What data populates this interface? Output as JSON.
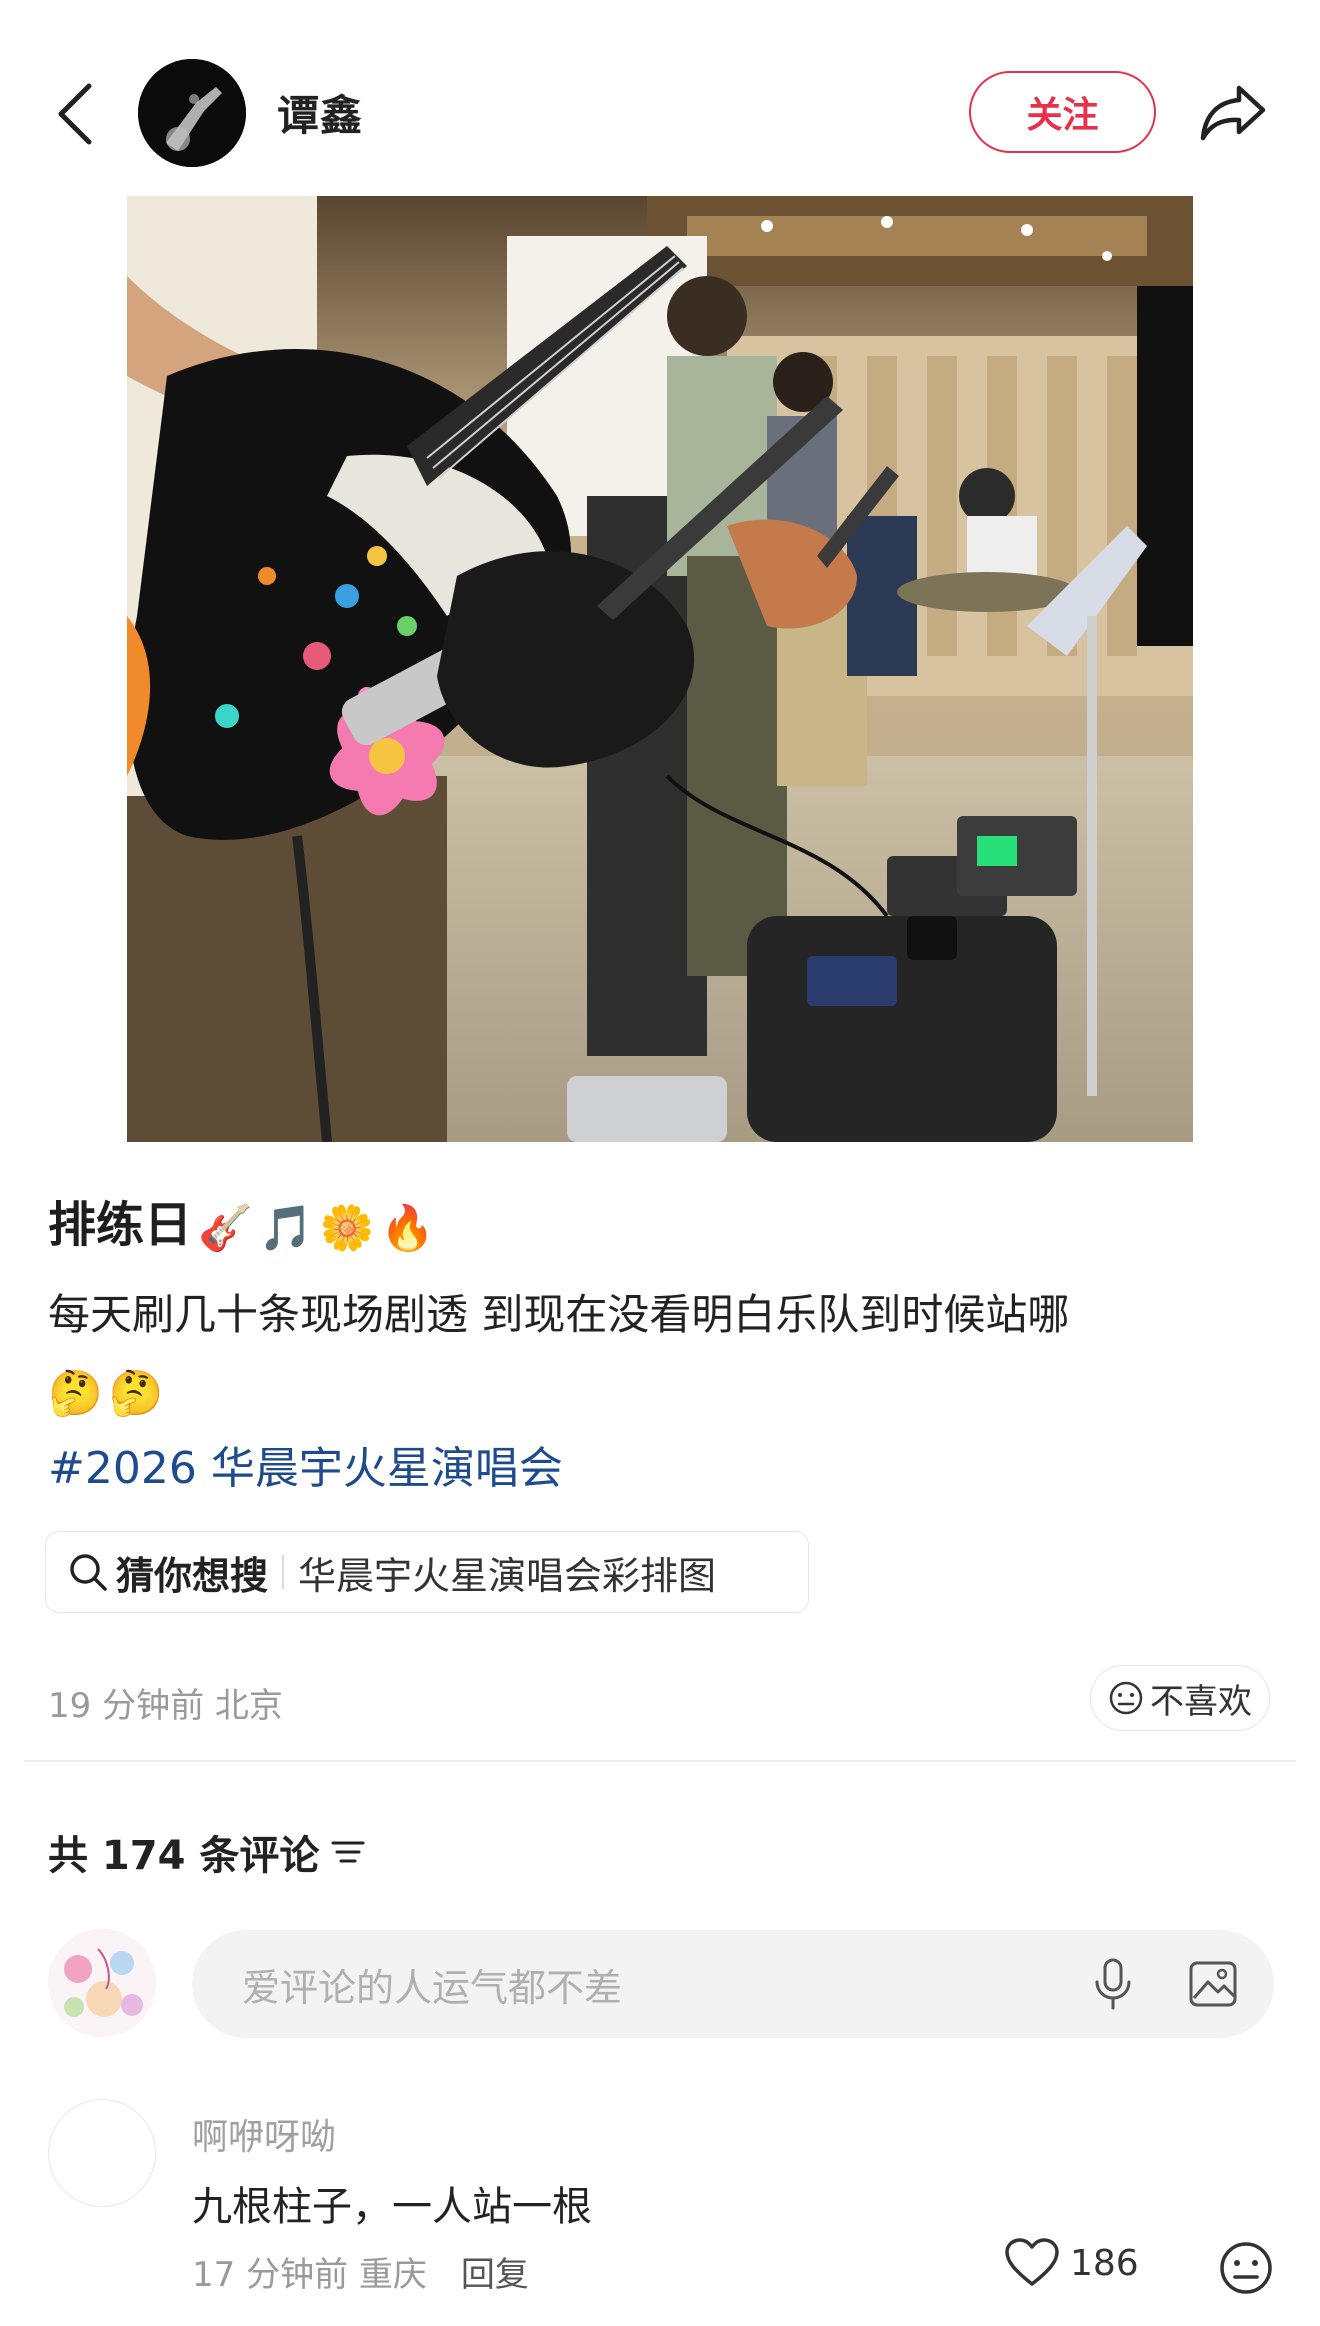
{
  "header": {
    "username": "谭鑫",
    "follow_label": "关注"
  },
  "post": {
    "title": "排练日",
    "title_emojis": [
      "🎸",
      "🎵",
      "🌼",
      "🔥"
    ],
    "body": "每天刷几十条现场剧透 到现在没看明白乐队到时候站哪",
    "body_emojis": [
      "🤔",
      "🤔"
    ],
    "hashtag": "#2026 华晨宇火星演唱会",
    "search_hint": {
      "lead": "猜你想搜",
      "query": "华晨宇火星演唱会彩排图"
    },
    "meta": "19 分钟前 北京",
    "dislike_label": "不喜欢"
  },
  "comments_section": {
    "count_label": "共 174 条评论",
    "input_placeholder": "爱评论的人运气都不差"
  },
  "comments": [
    {
      "user": "啊咿呀呦",
      "text": "九根柱子，一人站一根",
      "time_location": "17 分钟前 重庆",
      "reply_label": "回复",
      "likes": "186"
    }
  ],
  "colors": {
    "accent": "#e8304a",
    "hashtag": "#1f4b8c",
    "muted": "#9a9a9a"
  }
}
